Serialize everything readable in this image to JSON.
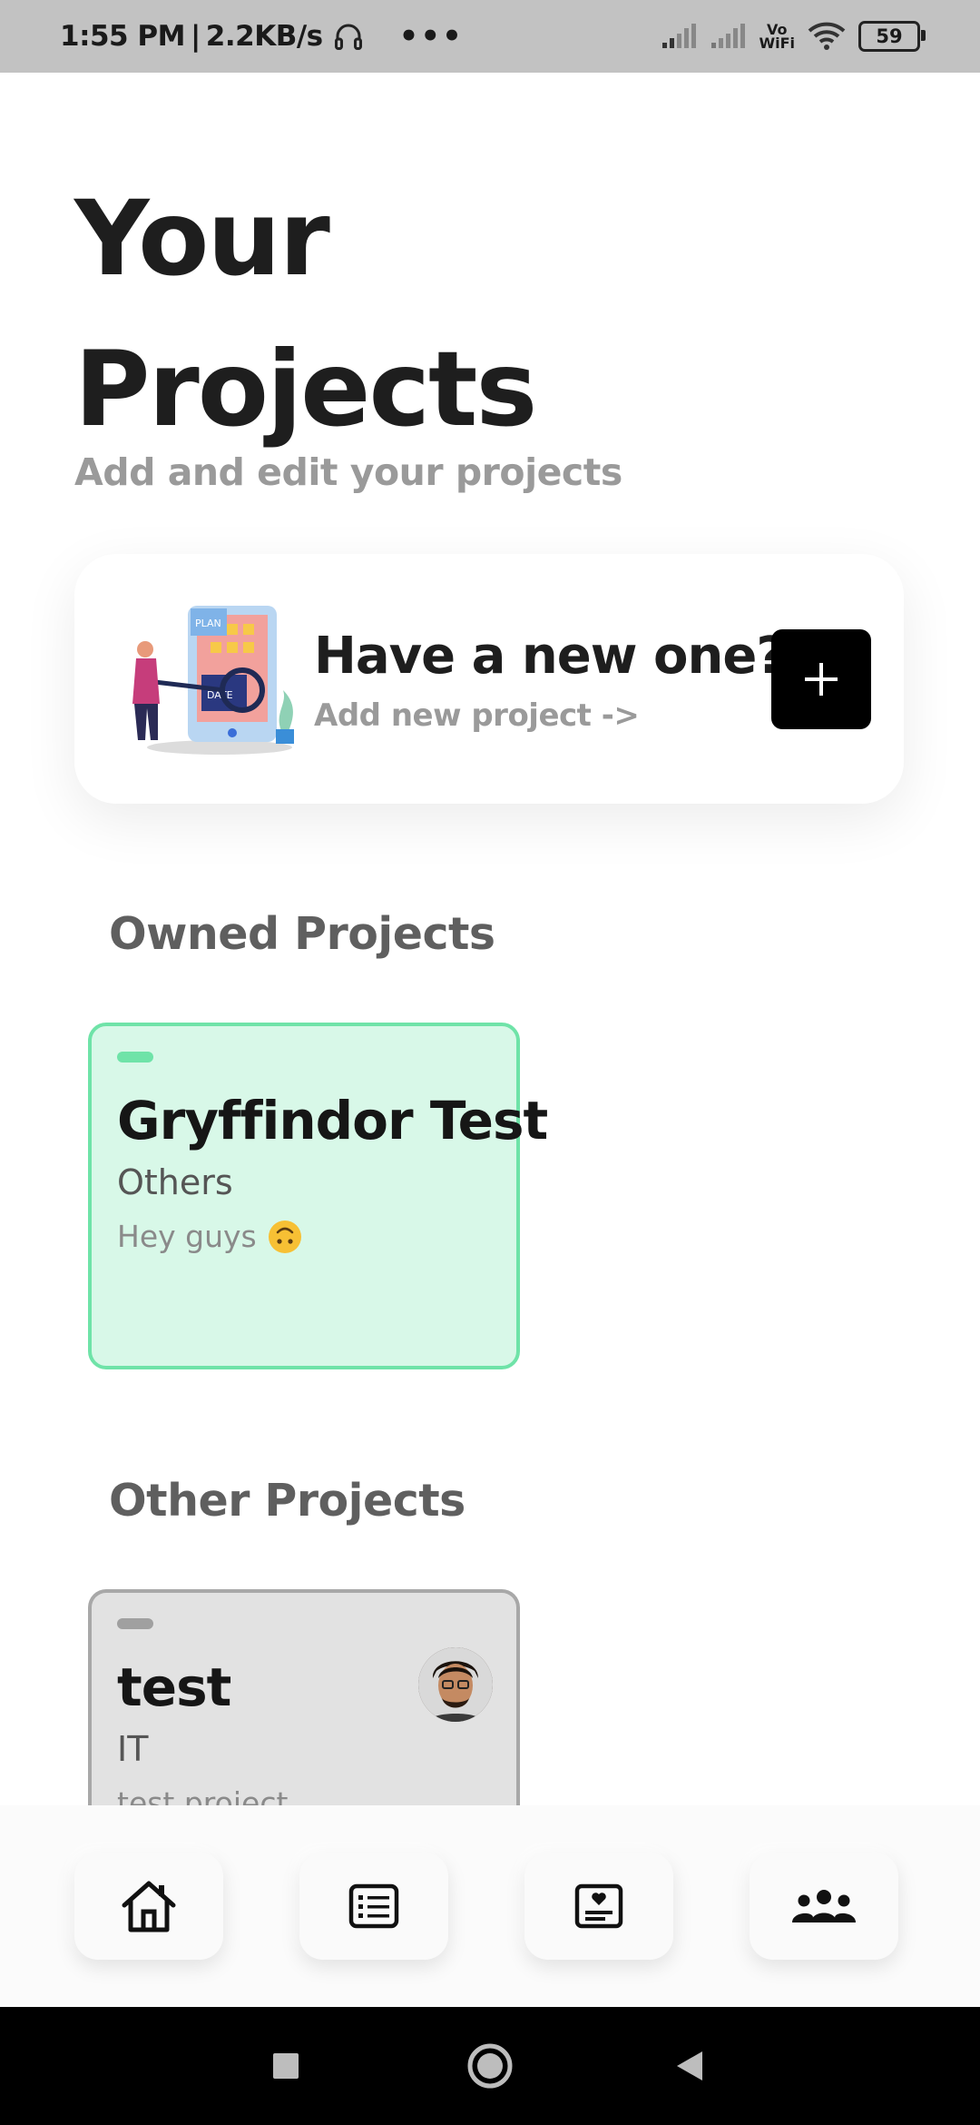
{
  "status_bar": {
    "time": "1:55 PM",
    "separator": "|",
    "net_speed": "2.2KB/s",
    "more": "•••",
    "vowifi_top": "Vo",
    "vowifi_bottom": "WiFi",
    "battery": "59"
  },
  "header": {
    "title_line1": "Your",
    "title_line2": "Projects",
    "subtitle": "Add and edit your projects"
  },
  "new_project_card": {
    "title": "Have a new one?",
    "subtitle": "Add new project  ->",
    "add_label": "+",
    "illustration_label_plan": "PLAN",
    "illustration_label_date": "DATE"
  },
  "owned_section": {
    "title": "Owned Projects",
    "projects": [
      {
        "name": "Gryffindor Test",
        "category": "Others",
        "description": "Hey guys",
        "accent": "#6fe3a8"
      }
    ]
  },
  "other_section": {
    "title": "Other Projects",
    "projects": [
      {
        "name": "test",
        "category": "IT",
        "description": "test project",
        "accent": "#a0a0a0"
      }
    ]
  },
  "bottom_nav": {
    "items": [
      {
        "icon": "home-icon"
      },
      {
        "icon": "list-icon"
      },
      {
        "icon": "favorites-card-icon"
      },
      {
        "icon": "people-group-icon"
      }
    ]
  },
  "colors": {
    "owned_bg": "#d8f8e8",
    "owned_border": "#6fe3a8",
    "other_bg": "#e2e2e2",
    "status_bar": "#c2c2c2"
  }
}
